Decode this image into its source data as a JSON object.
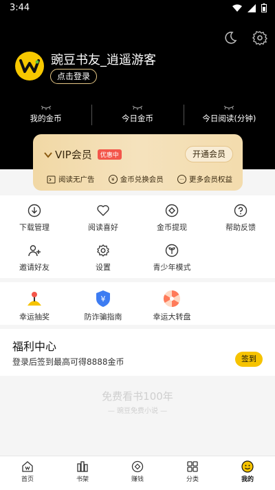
{
  "status_bar": {
    "time": "3:44"
  },
  "profile": {
    "name": "豌豆书友_逍遥游客",
    "login_label": "点击登录"
  },
  "stats": [
    {
      "label": "我的金币"
    },
    {
      "label": "今日金币"
    },
    {
      "label": "今日阅读(分钟)"
    }
  ],
  "vip": {
    "title": "VIP会员",
    "badge": "优惠中",
    "open_label": "开通会员",
    "perks": [
      "阅读无广告",
      "金币兑换会员",
      "更多会员权益"
    ]
  },
  "menu": [
    {
      "label": "下载管理",
      "icon": "download-icon"
    },
    {
      "label": "阅读喜好",
      "icon": "heart-icon"
    },
    {
      "label": "金币提现",
      "icon": "coin-withdraw-icon"
    },
    {
      "label": "帮助反馈",
      "icon": "help-icon"
    },
    {
      "label": "邀请好友",
      "icon": "invite-icon"
    },
    {
      "label": "设置",
      "icon": "settings-icon"
    },
    {
      "label": "青少年模式",
      "icon": "teen-mode-icon"
    }
  ],
  "tools": [
    {
      "label": "幸运抽奖",
      "icon": "joystick-icon"
    },
    {
      "label": "防诈骗指南",
      "icon": "shield-icon"
    },
    {
      "label": "幸运大转盘",
      "icon": "wheel-icon"
    }
  ],
  "welfare": {
    "title": "福利中心",
    "subtitle": "登录后签到最高可得8888金币",
    "signin_label": "签到"
  },
  "promo": {
    "headline": "免费看书100年",
    "tagline": "— 豌豆免费小说 —"
  },
  "nav": [
    {
      "label": "首页",
      "icon": "home-icon"
    },
    {
      "label": "书架",
      "icon": "bookshelf-icon"
    },
    {
      "label": "赚钱",
      "icon": "earn-icon"
    },
    {
      "label": "分类",
      "icon": "category-icon"
    },
    {
      "label": "我的",
      "icon": "profile-icon",
      "active": true
    }
  ],
  "colors": {
    "header_bg": "#000000",
    "accent_yellow": "#f6c300",
    "vip_gold": "#f1d8a5",
    "badge_red": "#f3564a"
  }
}
